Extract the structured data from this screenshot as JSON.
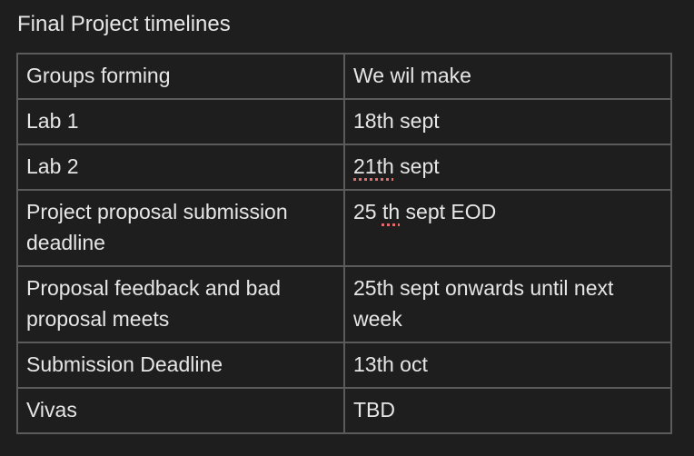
{
  "title": "Final Project timelines",
  "colors": {
    "background": "#1e1e1e",
    "text": "#e6e6e6",
    "border": "#5b5b5b",
    "spellcheck": "#e36b6b"
  },
  "table": {
    "rows": [
      {
        "task": "Groups forming",
        "date": "We wil make"
      },
      {
        "task": "Lab 1",
        "date": "18th sept"
      },
      {
        "task": "Lab 2",
        "date_prefix": "21th",
        "date_suffix": " sept"
      },
      {
        "task": "Project proposal submission deadline",
        "date_a": "25 ",
        "date_b": "th",
        "date_c": " sept EOD"
      },
      {
        "task": "Proposal feedback and bad proposal meets",
        "date": "25th sept onwards until next week"
      },
      {
        "task": "Submission Deadline",
        "date": "13th oct"
      },
      {
        "task": "Vivas",
        "date": "TBD"
      }
    ]
  }
}
